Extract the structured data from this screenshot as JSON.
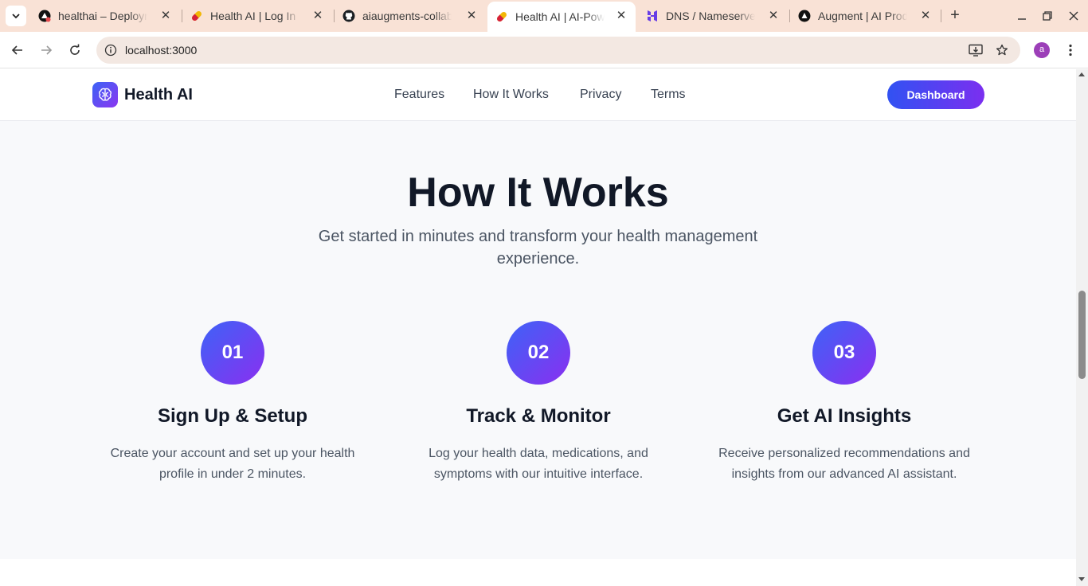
{
  "browser": {
    "tabs": [
      {
        "title": "healthai – Deployments",
        "icon": "vercel-icon",
        "active": false
      },
      {
        "title": "Health AI | Log In",
        "icon": "pill-icon",
        "active": false
      },
      {
        "title": "aiaugments-collab",
        "icon": "github-icon",
        "active": false
      },
      {
        "title": "Health AI | AI-Powered",
        "icon": "pill-icon",
        "active": true
      },
      {
        "title": "DNS / Nameservers",
        "icon": "hostinger-icon",
        "active": false
      },
      {
        "title": "Augment | AI Product",
        "icon": "augment-icon",
        "active": false
      }
    ],
    "url": "localhost:3000",
    "profile_initial": "a",
    "colors": {
      "tabstrip": "#f9e2d6",
      "omnibox": "#f3e8e2",
      "profile": "#9c3fb8"
    }
  },
  "site": {
    "brand": "Health AI",
    "nav": {
      "features": "Features",
      "how_it_works": "How It Works",
      "privacy": "Privacy",
      "terms": "Terms"
    },
    "dashboard_label": "Dashboard",
    "colors": {
      "gradient_start": "#3b63f6",
      "gradient_end": "#8b36f0"
    }
  },
  "how_it_works": {
    "title": "How It Works",
    "subtitle": "Get started in minutes and transform your health management experience.",
    "steps": [
      {
        "number": "01",
        "title": "Sign Up & Setup",
        "description": "Create your account and set up your health profile in under 2 minutes."
      },
      {
        "number": "02",
        "title": "Track & Monitor",
        "description": "Log your health data, medications, and symptoms with our intuitive interface."
      },
      {
        "number": "03",
        "title": "Get AI Insights",
        "description": "Receive personalized recommendations and insights from our advanced AI assistant."
      }
    ]
  }
}
